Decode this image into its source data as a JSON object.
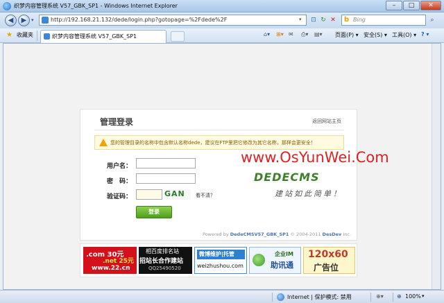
{
  "window": {
    "title": "织梦内容管理系统 V57_GBK_SP1 - Windows Internet Explorer",
    "controls": {
      "minimize": "–",
      "maximize": "□",
      "close": "✕"
    }
  },
  "address_bar": {
    "url": "http://192.168.21.132/dede/login.php?gotopage=%2Fdede%2F",
    "search_placeholder": "Bing"
  },
  "command_bar": {
    "favorites_label": "收藏夹",
    "tab_label": "织梦内容管理系统 V57_GBK_SP1",
    "menus": {
      "page": "页面(P) ▾",
      "safety": "安全(S) ▾",
      "tools": "工具(O) ▾",
      "help": "? ▾"
    }
  },
  "login": {
    "title": "管理登录",
    "back_link": "返回网站主页",
    "warning": "您的管理目录的名称中包含默认名称dede，建议在FTP里把它修改为其它名称，那样会更安全！",
    "username_label": "用户名：",
    "password_label": "密　码：",
    "captcha_label": "验证码：",
    "captcha_text": "GAN",
    "captcha_hint": "看不清？",
    "submit_label": "登录",
    "logo_text": "DEDECMS",
    "slogan": "建站如此简单！",
    "footer_prefix": "Powered by ",
    "footer_brand": "DedeCMSV57_GBK_SP1",
    "footer_suffix": " © 2004-2011 ",
    "footer_company": "DesDev",
    "footer_inc": " Inc."
  },
  "watermark": "www.OsYunWei.Com",
  "ads": [
    {
      "line1": ".com 30元",
      "line2": ".net 25元",
      "line3": "www.22.cn",
      "bg": "#d4101a"
    },
    {
      "line1": "相百度排名站",
      "line2": "招站长合作建站",
      "line3": "QQ25490520",
      "bg": "#111111"
    },
    {
      "line1": "微博维护|托管",
      "line2": "weizhushou.com",
      "bg": "#ffffff"
    },
    {
      "line1": "企业IM",
      "line2": "助讯通",
      "bg": "#eef5ff"
    },
    {
      "line1": "120x60",
      "line2": "广告位",
      "bg": "#fff7cc"
    }
  ],
  "status_bar": {
    "zone": "Internet | 保护模式: 禁用",
    "zoom": "100%"
  },
  "colors": {
    "accent_green": "#4e9e1c",
    "watermark_red": "#dd2222",
    "warning_orange": "#f2a100"
  }
}
